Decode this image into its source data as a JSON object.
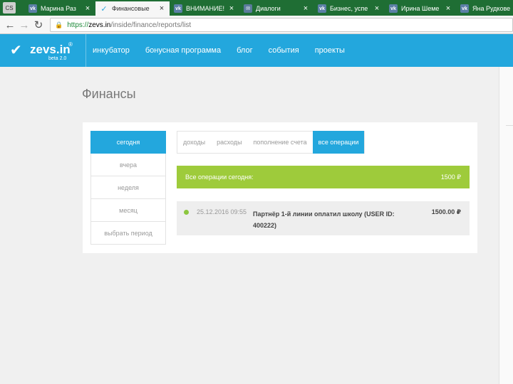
{
  "browser": {
    "corner": "CS",
    "tabs": [
      {
        "label": "Марина Раз",
        "icon": "vk-icon",
        "active": false
      },
      {
        "label": "Финансовые",
        "icon": "zevs-icon",
        "active": true
      },
      {
        "label": "ВНИМАНИЕ!",
        "icon": "vk-icon",
        "active": false
      },
      {
        "label": "Диалоги",
        "icon": "chat-icon",
        "active": false
      },
      {
        "label": "Бизнес, успе",
        "icon": "vk-icon",
        "active": false
      },
      {
        "label": "Ирина Шеме",
        "icon": "vk-icon",
        "active": false
      },
      {
        "label": "Яна Рудкове",
        "icon": "vk-icon",
        "active": false
      }
    ],
    "close_glyph": "×",
    "url_scheme": "https://",
    "url_host": "zevs.in",
    "url_path": "/inside/finance/reports/list"
  },
  "header": {
    "logo_text": "zevs.in",
    "logo_sup": "®",
    "logo_beta": "beta 2.0",
    "nav": [
      "инкубатор",
      "бонусная программа",
      "блог",
      "события",
      "проекты"
    ]
  },
  "page": {
    "title": "Финансы",
    "periods": [
      "сегодня",
      "вчера",
      "неделя",
      "месяц",
      "выбрать период"
    ],
    "active_period": 0,
    "type_tabs": [
      "доходы",
      "расходы",
      "пополнение счета",
      "все операции"
    ],
    "active_type_tab": 3,
    "summary_label": "Все операции сегодня:",
    "summary_amount": "1500 ₽",
    "operations": [
      {
        "date": "25.12.2016 09:55",
        "description": "Партнёр 1-й линии оплатил школу (USER ID: 400222)",
        "amount": "1500.00 ₽"
      }
    ]
  },
  "colors": {
    "brand_blue": "#23a7dd",
    "summary_green": "#9ecb3b",
    "tabstrip_green": "#1f6e34",
    "status_dot": "#8cc63f"
  }
}
